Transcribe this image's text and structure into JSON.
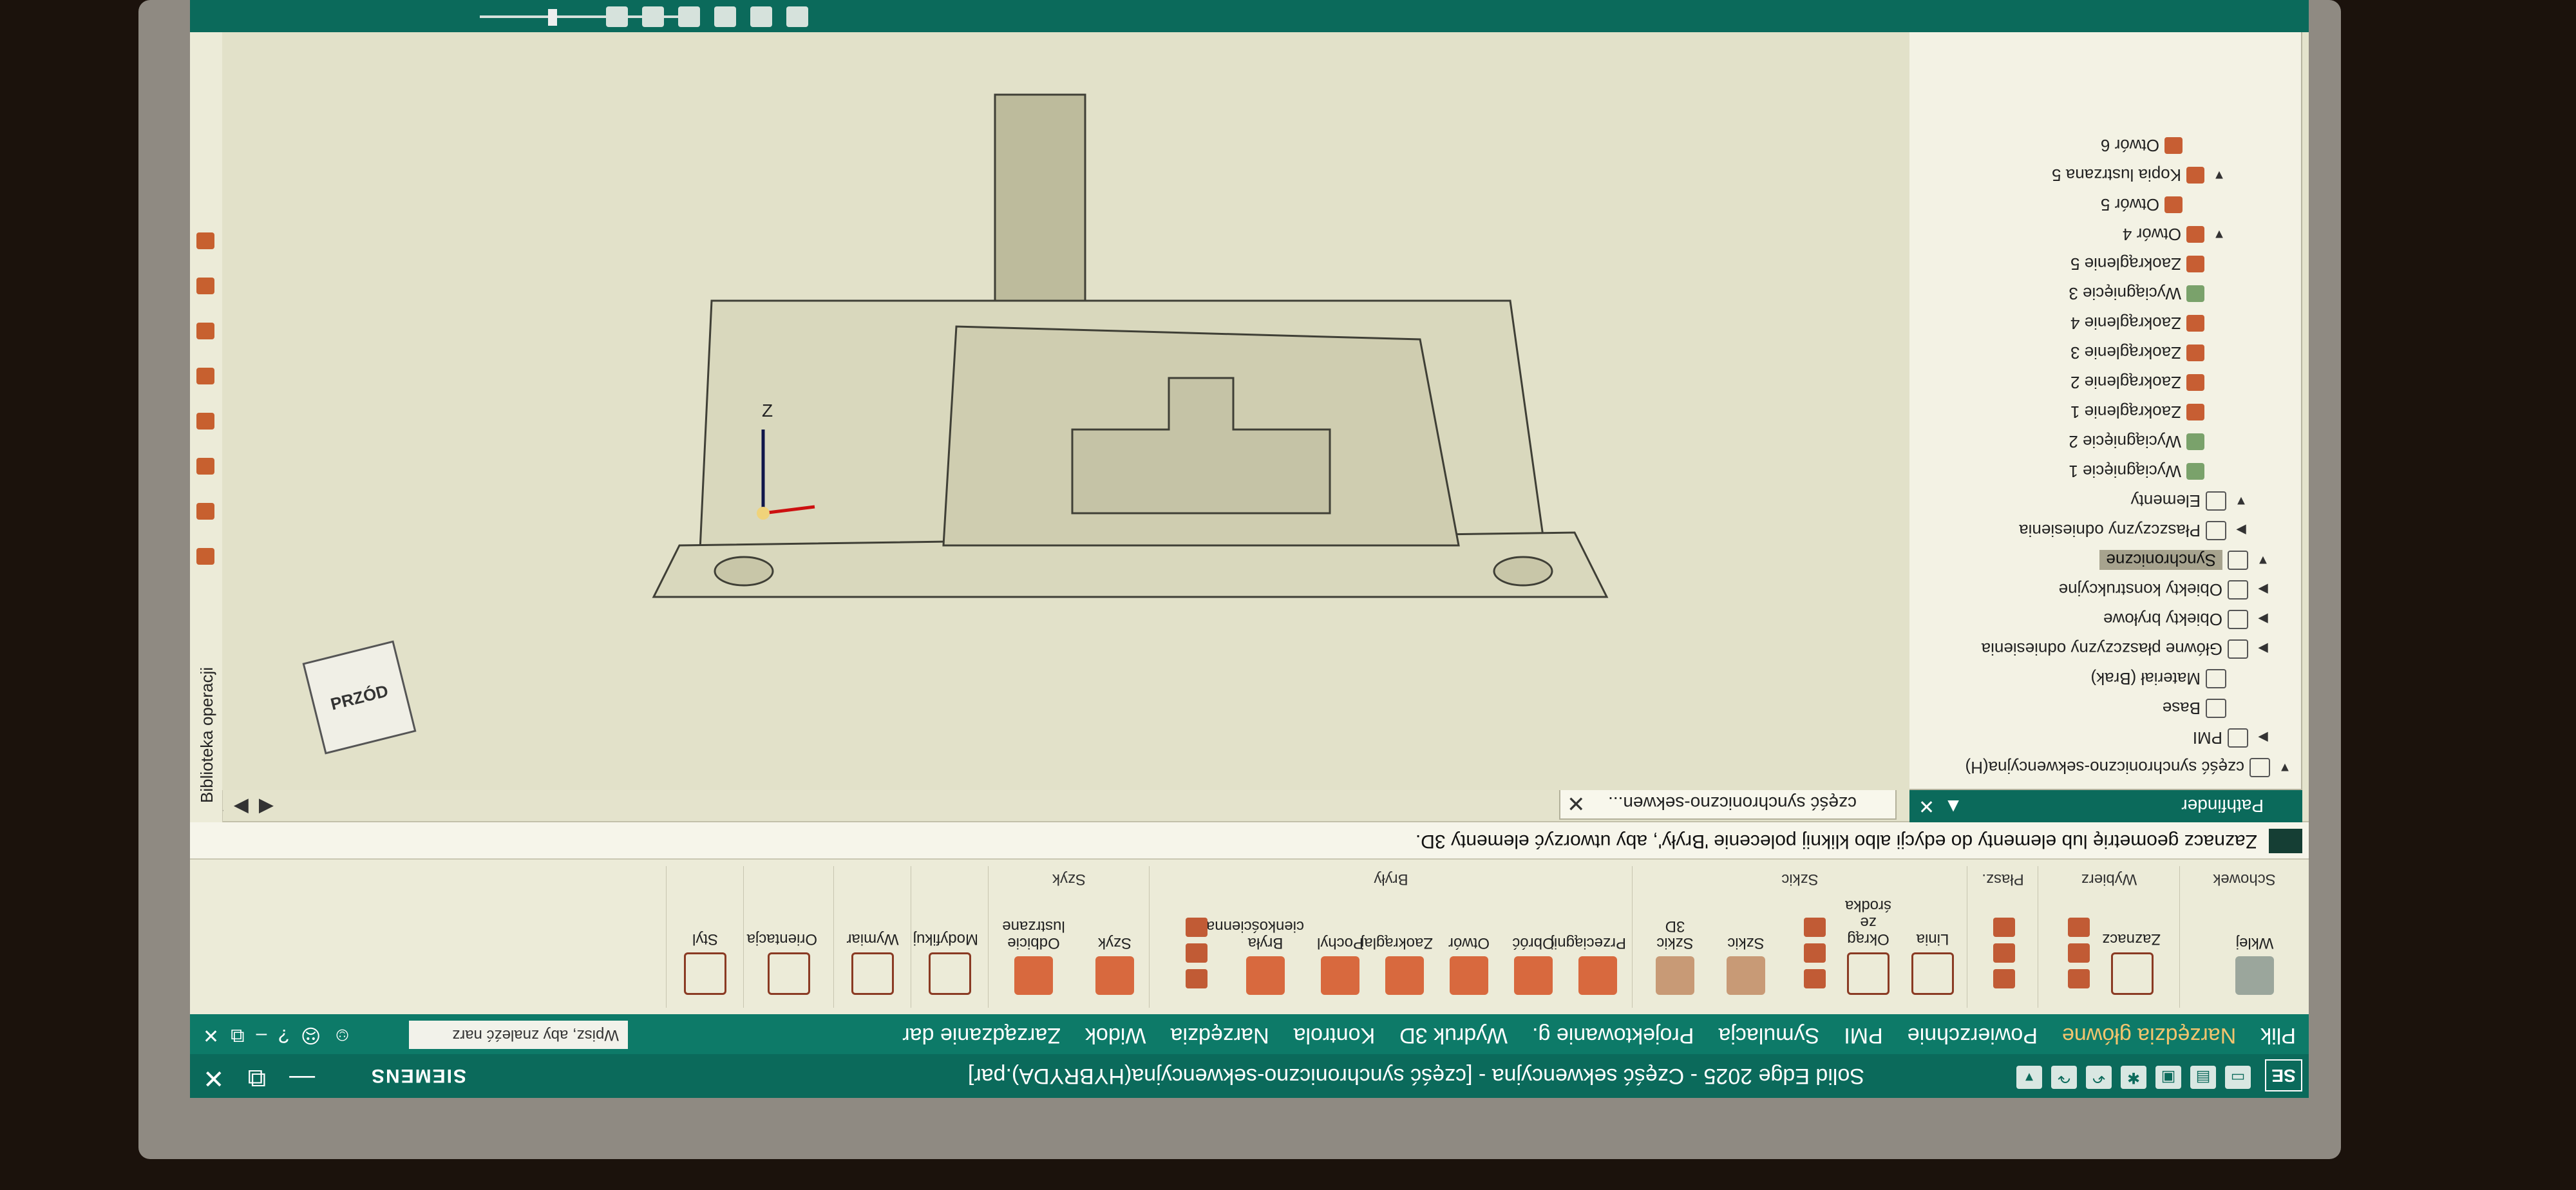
{
  "window": {
    "app_logo": "SE",
    "title": "Solid Edge 2025 - Część sekwencyjna - [część synchroniczno-sekwencyjna(HYBRYDA).par]",
    "brand": "SIEMENS",
    "controls": [
      "—",
      "⧉",
      "✕"
    ]
  },
  "menu": {
    "tabs": [
      "Plik",
      "Narzędzia główne",
      "Powierzchnie",
      "PMI",
      "Symulacja",
      "Projektowanie g.",
      "Wydruk 3D",
      "Kontrola",
      "Narzędzia",
      "Widok",
      "Zarządzanie dar"
    ],
    "active_tab": "Narzędzia główne",
    "help_placeholder": "Wpisz, aby znaleźć narz",
    "right_controls": [
      "☺",
      "☹",
      "?",
      "–",
      "⧉",
      "✕"
    ]
  },
  "ribbon": {
    "schowek": {
      "name": "Schowek",
      "paste": "Wklej"
    },
    "wybierz": {
      "name": "Wybierz",
      "select": "Zaznacz"
    },
    "plaszczyzny": {
      "name": "Płasz."
    },
    "szkic": {
      "name": "Szkic",
      "linia": "Linia",
      "okrag": "Okrąg ze środka",
      "szkic": "Szkic",
      "szkic3d": "Szkic 3D"
    },
    "bryly": {
      "name": "Bryły",
      "przeciagnij": "Przeciągnij",
      "obroc": "Obróć",
      "otwor": "Otwór",
      "zaokraglaj": "Zaokrąglaj",
      "pochyl": "Pochyl",
      "bryla": "Bryła cienkościenna"
    },
    "szyk": {
      "name": "Szyk",
      "szyk": "Szyk",
      "odbicie": "Odbicie lustrzane"
    },
    "modyfikuj": {
      "name": "Modyfikuj"
    },
    "wymiar": {
      "name": "Wymiar"
    },
    "orientacja": {
      "name": "Orientacja"
    },
    "styl": {
      "name": "Styl"
    }
  },
  "prompt": "Zaznacz geometrię lub elementy do edycji albo kliknij polecenie 'Bryły', aby utworzyć elementy 3D.",
  "document_tab": "część synchroniczno-sekwen...",
  "pathfinder": {
    "title": "Pathfinder",
    "items": [
      {
        "label": "część synchroniczno-sekwencyjna(H)",
        "indent": 0,
        "caret": "▼"
      },
      {
        "label": "PMI",
        "indent": 1,
        "caret": "▶"
      },
      {
        "label": "Base",
        "indent": 2,
        "caret": ""
      },
      {
        "label": "Materiał (Brak)",
        "indent": 2,
        "caret": ""
      },
      {
        "label": "Główne płaszczyzny odniesienia",
        "indent": 1,
        "caret": "▶"
      },
      {
        "label": "Obiekty bryłowe",
        "indent": 1,
        "caret": "▶"
      },
      {
        "label": "Obiekty konstrukcyjne",
        "indent": 1,
        "caret": "▶"
      },
      {
        "label": "Synchroniczne",
        "indent": 1,
        "caret": "▼",
        "selected": true
      },
      {
        "label": "Płaszczyzny odniesienia",
        "indent": 2,
        "caret": "▶"
      },
      {
        "label": "Elementy",
        "indent": 2,
        "caret": "▼"
      },
      {
        "label": "Wyciągnięcie 1",
        "indent": 3,
        "caret": ""
      },
      {
        "label": "Wyciągnięcie 2",
        "indent": 3,
        "caret": ""
      },
      {
        "label": "Zaokrąglenie 1",
        "indent": 3,
        "caret": ""
      },
      {
        "label": "Zaokrąglenie 2",
        "indent": 3,
        "caret": ""
      },
      {
        "label": "Zaokrąglenie 3",
        "indent": 3,
        "caret": ""
      },
      {
        "label": "Zaokrąglenie 4",
        "indent": 3,
        "caret": ""
      },
      {
        "label": "Wyciągnięcie 3",
        "indent": 3,
        "caret": ""
      },
      {
        "label": "Zaokrąglenie 5",
        "indent": 3,
        "caret": ""
      },
      {
        "label": "Otwór 4",
        "indent": 3,
        "caret": "▼"
      },
      {
        "label": "Otwór 5",
        "indent": 4,
        "caret": ""
      },
      {
        "label": "Kopia lustrzana 5",
        "indent": 3,
        "caret": "▼"
      },
      {
        "label": "Otwór 6",
        "indent": 4,
        "caret": ""
      }
    ]
  },
  "library": {
    "label": "Biblioteka operacji"
  },
  "viewport": {
    "axis_label": "Z",
    "viewcube_face": "PRZÓD"
  },
  "colors": {
    "accent": "#0b6a5b",
    "ribbon_bg": "#ecebd8",
    "viewport_bg": "#e2e1c9",
    "feature_orange": "#d8693e"
  }
}
